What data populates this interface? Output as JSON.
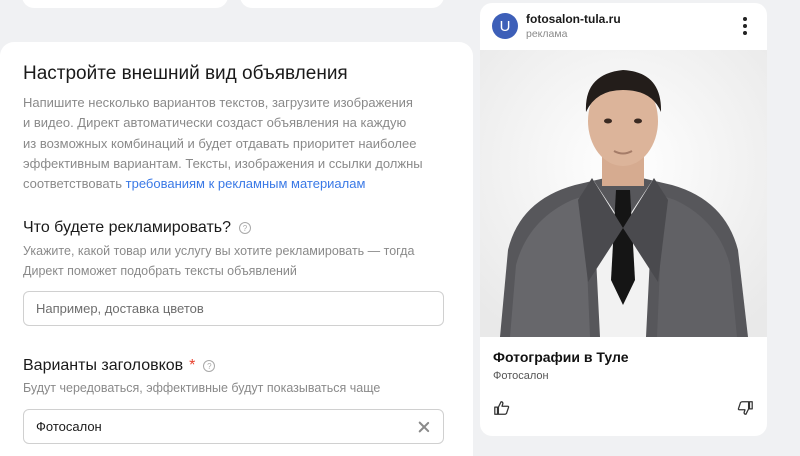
{
  "form": {
    "title": "Настройте внешний вид объявления",
    "description_line1": "Напишите несколько вариантов текстов, загрузите изображения",
    "description_line2": "и видео. Директ автоматически создаст объявления на каждую",
    "description_line3": "из возможных комбинаций и будет отдавать приоритет наиболее",
    "description_line4": "эффективным вариантам. Тексты, изображения и ссылки должны",
    "description_line5_prefix": "соответствовать ",
    "description_link": "требованиям к рекламным материалам",
    "what_section": {
      "heading": "Что будете рекламировать?",
      "hint_line1": "Укажите, какой товар или услугу вы хотите рекламировать — тогда",
      "hint_line2": "Директ поможет подобрать тексты объявлений",
      "placeholder": "Например, доставка цветов",
      "value": ""
    },
    "headline_section": {
      "heading": "Варианты заголовков",
      "required_mark": "*",
      "hint": "Будут чередоваться, эффективные будут показываться чаще",
      "value": "Фотосалон"
    }
  },
  "preview": {
    "logo_letter": "U",
    "domain": "fotosalon-tula.ru",
    "ad_label": "реклама",
    "title": "Фотографии в Туле",
    "subtitle": "Фотосалон"
  },
  "colors": {
    "accent_link": "#3a79e6",
    "required": "#e8412e",
    "logo_bg": "#3d5fb8",
    "page_bg": "#f0f1f3"
  }
}
